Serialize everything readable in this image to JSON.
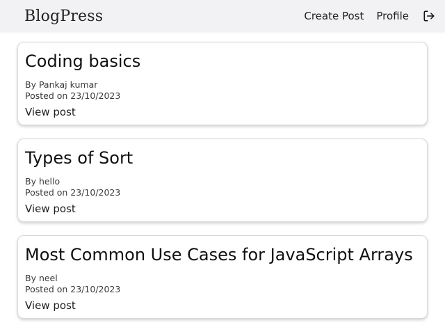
{
  "header": {
    "brand": "BlogPress",
    "nav": {
      "create_post": "Create Post",
      "profile": "Profile"
    },
    "logout_icon": "logout-icon"
  },
  "posts": [
    {
      "title": "Coding basics",
      "author_line": "By Pankaj kumar",
      "posted_line": "Posted on 23/10/2023",
      "view_label": "View post"
    },
    {
      "title": "Types of Sort",
      "author_line": "By hello",
      "posted_line": "Posted on 23/10/2023",
      "view_label": "View post"
    },
    {
      "title": "Most Common Use Cases for JavaScript Arrays",
      "author_line": "By neel",
      "posted_line": "Posted on 23/10/2023",
      "view_label": "View post"
    }
  ],
  "colors": {
    "topbar_bg": "#f2f2f4",
    "text_primary": "#101010",
    "text_secondary": "#3a3a3a",
    "card_border": "#d8d8d8"
  }
}
